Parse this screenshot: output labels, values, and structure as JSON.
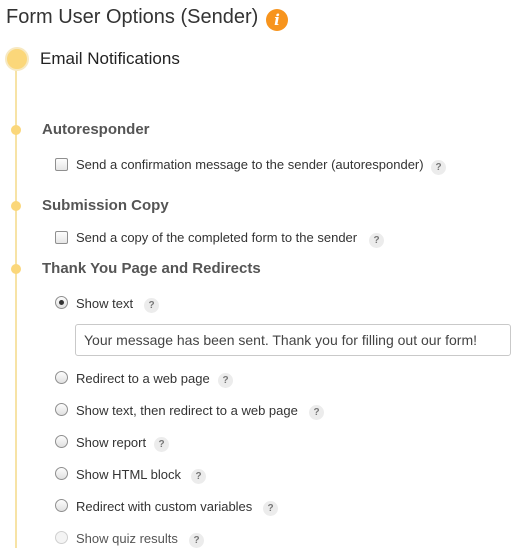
{
  "title": "Form User Options (Sender)",
  "info_icon": "info-icon",
  "accent_color": "#fbd77a",
  "email_notifications": {
    "heading": "Email Notifications"
  },
  "autoresponder": {
    "heading": "Autoresponder",
    "option_label": "Send a confirmation message to the sender (autoresponder)",
    "checked": false,
    "help": "?"
  },
  "submission_copy": {
    "heading": "Submission Copy",
    "option_label": "Send a copy of the completed form to the sender",
    "checked": false,
    "help": "?"
  },
  "thank_you": {
    "heading": "Thank You Page and Redirects",
    "message_value": "Your message has been sent. Thank you for filling out our form!",
    "options": [
      {
        "label": "Show text",
        "selected": true,
        "disabled": false,
        "help": "?"
      },
      {
        "label": "Redirect to a web page",
        "selected": false,
        "disabled": false,
        "help": "?"
      },
      {
        "label": "Show text, then redirect to a web page",
        "selected": false,
        "disabled": false,
        "help": "?"
      },
      {
        "label": "Show report",
        "selected": false,
        "disabled": false,
        "help": "?"
      },
      {
        "label": "Show HTML block",
        "selected": false,
        "disabled": false,
        "help": "?"
      },
      {
        "label": "Redirect with custom variables",
        "selected": false,
        "disabled": false,
        "help": "?"
      },
      {
        "label": "Show quiz results",
        "selected": false,
        "disabled": true,
        "help": "?"
      }
    ]
  }
}
